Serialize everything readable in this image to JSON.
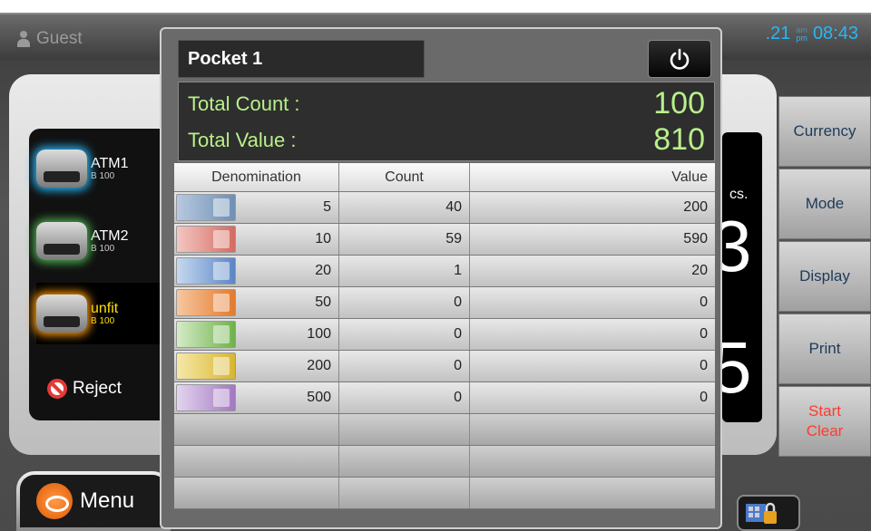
{
  "header": {
    "user": "Guest",
    "date_fragment": ".21",
    "am_label": "am",
    "pm_label": "pm",
    "time": "08:43"
  },
  "pockets": [
    {
      "name": "ATM1",
      "sub": "B 100",
      "glow": "#29b6f6"
    },
    {
      "name": "ATM2",
      "sub": "B 100",
      "glow": "#4caf50"
    },
    {
      "name": "unfit",
      "sub": "B 100",
      "glow": "#ff9800"
    }
  ],
  "reject_label": "Reject",
  "menu_label": "Menu",
  "background_display": {
    "pcs_fragment": "cs.",
    "digit_top": "3",
    "digit_bottom": "5"
  },
  "side_buttons": [
    {
      "label": "Currency"
    },
    {
      "label": "Mode"
    },
    {
      "label": "Display"
    },
    {
      "label": "Print"
    },
    {
      "label_line1": "Start",
      "label_line2": "Clear",
      "color": "#ff3b30"
    }
  ],
  "modal": {
    "title": "Pocket 1",
    "power_icon": "power-icon",
    "total_count_label": "Total Count :",
    "total_count_value": "100",
    "total_value_label": "Total Value :",
    "total_value_value": "810",
    "total_color": "#b8f08a",
    "columns": [
      "Denomination",
      "Count",
      "Value"
    ],
    "rows": [
      {
        "denomination": "5",
        "count": "40",
        "value": "200",
        "note_icon": "euro-5-banknote-icon"
      },
      {
        "denomination": "10",
        "count": "59",
        "value": "590",
        "note_icon": "euro-10-banknote-icon"
      },
      {
        "denomination": "20",
        "count": "1",
        "value": "20",
        "note_icon": "euro-20-banknote-icon"
      },
      {
        "denomination": "50",
        "count": "0",
        "value": "0",
        "note_icon": "euro-50-banknote-icon"
      },
      {
        "denomination": "100",
        "count": "0",
        "value": "0",
        "note_icon": "euro-100-banknote-icon"
      },
      {
        "denomination": "200",
        "count": "0",
        "value": "0",
        "note_icon": "euro-200-banknote-icon"
      },
      {
        "denomination": "500",
        "count": "0",
        "value": "0",
        "note_icon": "euro-500-banknote-icon"
      }
    ]
  }
}
